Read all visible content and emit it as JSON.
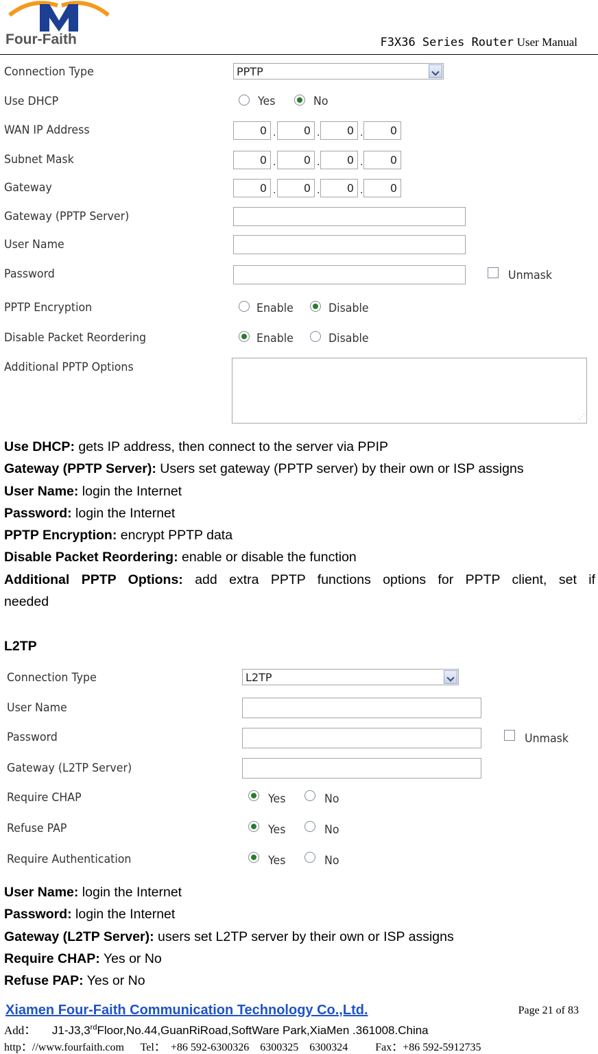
{
  "header": {
    "logo_text": "Four-Faith",
    "title_mono": "F3X36 Series Router",
    "title_serif": "User Manual"
  },
  "pptp_form": {
    "connection_type_label": "Connection Type",
    "connection_type_value": "PPTP",
    "use_dhcp_label": "Use DHCP",
    "yes": "Yes",
    "no": "No",
    "wan_ip_label": "WAN IP Address",
    "subnet_label": "Subnet Mask",
    "gateway_label": "Gateway",
    "octet": "0",
    "dot": ".",
    "gateway_server_label": "Gateway (PPTP Server)",
    "user_name_label": "User Name",
    "password_label": "Password",
    "unmask": "Unmask",
    "encryption_label": "PPTP Encryption",
    "enable": "Enable",
    "disable": "Disable",
    "reorder_label": "Disable Packet Reordering",
    "additional_label": "Additional PPTP Options"
  },
  "pptp_desc": [
    {
      "term": "Use DHCP:",
      "text": " gets IP address, then connect to the server via PPIP"
    },
    {
      "term": "Gateway (PPTP Server):",
      "text": " Users set gateway (PPTP server) by their own or ISP assigns"
    },
    {
      "term": "User Name:",
      "text": " login the Internet"
    },
    {
      "term": "Password:",
      "text": " login the Internet"
    },
    {
      "term": "PPTP Encryption:",
      "text": " encrypt PPTP data"
    },
    {
      "term": "Disable Packet Reordering:",
      "text": " enable or disable the function"
    }
  ],
  "additional_desc": {
    "term": "Additional PPTP Options:",
    "line1": "add extra PPTP functions options for PPTP client, set if",
    "line2": "needed"
  },
  "l2tp_heading": "L2TP",
  "l2tp_form": {
    "connection_type_label": "Connection Type",
    "connection_type_value": "L2TP",
    "user_name_label": "User Name",
    "password_label": "Password",
    "unmask": "Unmask",
    "gateway_label": "Gateway (L2TP Server)",
    "require_chap_label": "Require CHAP",
    "refuse_pap_label": "Refuse PAP",
    "require_auth_label": "Require Authentication",
    "yes": "Yes",
    "no": "No"
  },
  "l2tp_desc": [
    {
      "term": "User Name:",
      "text": " login the Internet"
    },
    {
      "term": "Password:",
      "text": " login the Internet"
    },
    {
      "term": "Gateway (L2TP Server):",
      "text": " users set L2TP server by their own or ISP assigns"
    },
    {
      "term": "Require CHAP:",
      "text": " Yes or No"
    },
    {
      "term": "Refuse PAP:",
      "text": " Yes or No"
    }
  ],
  "footer": {
    "company": "Xiamen Four-Faith Communication Technology Co.,Ltd. ",
    "page": "Page 21 of 83",
    "add_label": "Add：",
    "address_pre": "J1-J3,3",
    "address_sup": "rd",
    "address_post": "Floor,No.44,GuanRiRoad,SoftWare Park,XiaMen .361008.China",
    "web": "http：//www.fourfaith.com      Tel：  +86 592-6300326    6300325    6300324          Fax：+86 592-5912735"
  }
}
